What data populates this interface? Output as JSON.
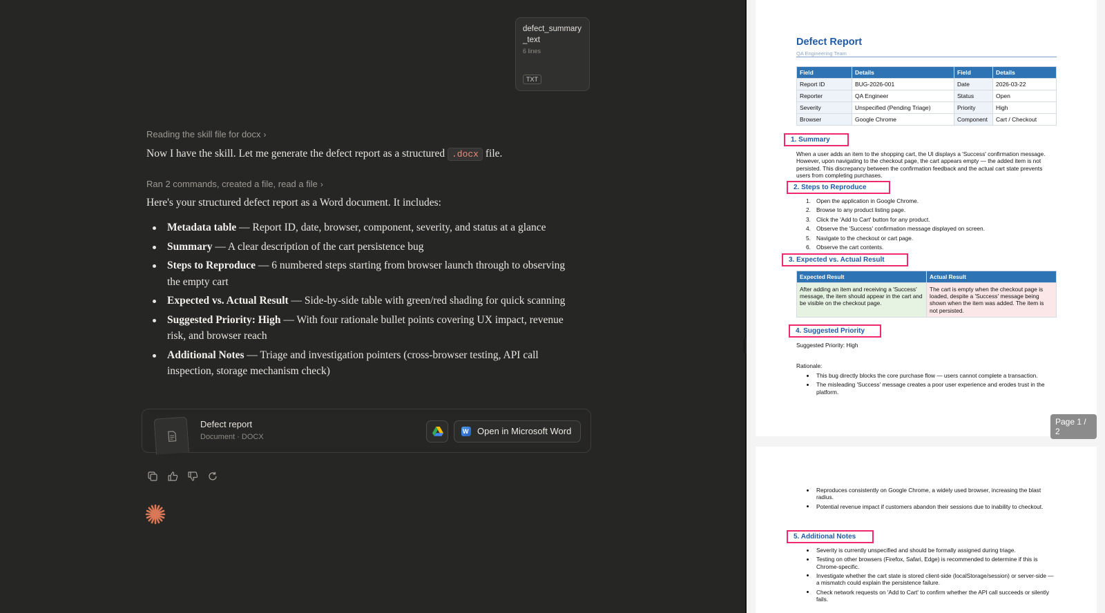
{
  "attachment": {
    "name": "defect_summary_text",
    "lines": "6 lines",
    "type": "TXT"
  },
  "chat": {
    "step1": "Reading the skill file for docx",
    "para1_before": "Now I have the skill. Let me generate the defect report as a structured",
    "para1_code": ".docx",
    "para1_after": "file.",
    "step2": "Ran 2 commands, created a file, read a file",
    "para2": "Here's your structured defect report as a Word document. It includes:",
    "features": [
      {
        "title": "Metadata table",
        "text": " — Report ID, date, browser, component, severity, and status at a glance"
      },
      {
        "title": "Summary",
        "text": " — A clear description of the cart persistence bug"
      },
      {
        "title": "Steps to Reproduce",
        "text": " — 6 numbered steps starting from browser launch through to observing the empty cart"
      },
      {
        "title": "Expected vs. Actual Result",
        "text": " — Side-by-side table with green/red shading for quick scanning"
      },
      {
        "title": "Suggested Priority: High",
        "text": " — With four rationale bullet points covering UX impact, revenue risk, and browser reach"
      },
      {
        "title": "Additional Notes",
        "text": " — Triage and investigation pointers (cross-browser testing, API call inspection, storage mechanism check)"
      }
    ],
    "file_card": {
      "title": "Defect report",
      "subtitle": "Document · DOCX",
      "open_word": "Open in Microsoft Word"
    },
    "icons": {
      "copy": "copy-icon",
      "up": "thumbs-up-icon",
      "down": "thumbs-down-icon",
      "retry": "retry-icon",
      "spark": "claude-spark-icon"
    },
    "accent": "#d97757"
  },
  "doc": {
    "title": "Defect Report",
    "subtitle": "QA Engineering Team",
    "meta_headers": [
      "Field",
      "Details",
      "Field",
      "Details"
    ],
    "meta_rows": [
      [
        "Report ID",
        "BUG-2026-001",
        "Date",
        "2026-03-22"
      ],
      [
        "Reporter",
        "QA Engineer",
        "Status",
        "Open"
      ],
      [
        "Severity",
        "Unspecified (Pending Triage)",
        "Priority",
        "High"
      ],
      [
        "Browser",
        "Google Chrome",
        "Component",
        "Cart / Checkout"
      ]
    ],
    "s1": "1. Summary",
    "summary": "When a user adds an item to the shopping cart, the UI displays a 'Success' confirmation message. However, upon navigating to the checkout page, the cart appears empty — the added item is not persisted. This discrepancy between the confirmation feedback and the actual cart state prevents users from completing purchases.",
    "s2": "2. Steps to Reproduce",
    "steps": [
      "Open the application in Google Chrome.",
      "Browse to any product listing page.",
      "Click the 'Add to Cart' button for any product.",
      "Observe the 'Success' confirmation message displayed on screen.",
      "Navigate to the checkout or cart page.",
      "Observe the cart contents."
    ],
    "s3": "3. Expected vs. Actual Result",
    "expected_header": "Expected Result",
    "actual_header": "Actual Result",
    "expected": "After adding an item and receiving a 'Success' message, the item should appear in the cart and be visible on the checkout page.",
    "actual": "The cart is empty when the checkout page is loaded, despite a 'Success' message being shown when the item was added. The item is not persisted.",
    "s4": "4. Suggested Priority",
    "priority_line": "Suggested Priority: High",
    "rationale_label": "Rationale:",
    "rationale_p1": [
      "This bug directly blocks the core purchase flow — users cannot complete a transaction.",
      "The misleading 'Success' message creates a poor user experience and erodes trust in the platform."
    ],
    "page_label": "Page 1 / 2",
    "rationale_p2": [
      "Reproduces consistently on Google Chrome, a widely used browser, increasing the blast radius.",
      "Potential revenue impact if customers abandon their sessions due to inability to checkout."
    ],
    "s5": "5. Additional Notes",
    "notes": [
      "Severity is currently unspecified and should be formally assigned during triage.",
      "Testing on other browsers (Firefox, Safari, Edge) is recommended to determine if this is Chrome-specific.",
      "Investigate whether the cart state is stored client-side (localStorage/session) or server-side — a mismatch could explain the persistence failure.",
      "Check network requests on 'Add to Cart' to confirm whether the API call succeeds or silently fails."
    ]
  }
}
